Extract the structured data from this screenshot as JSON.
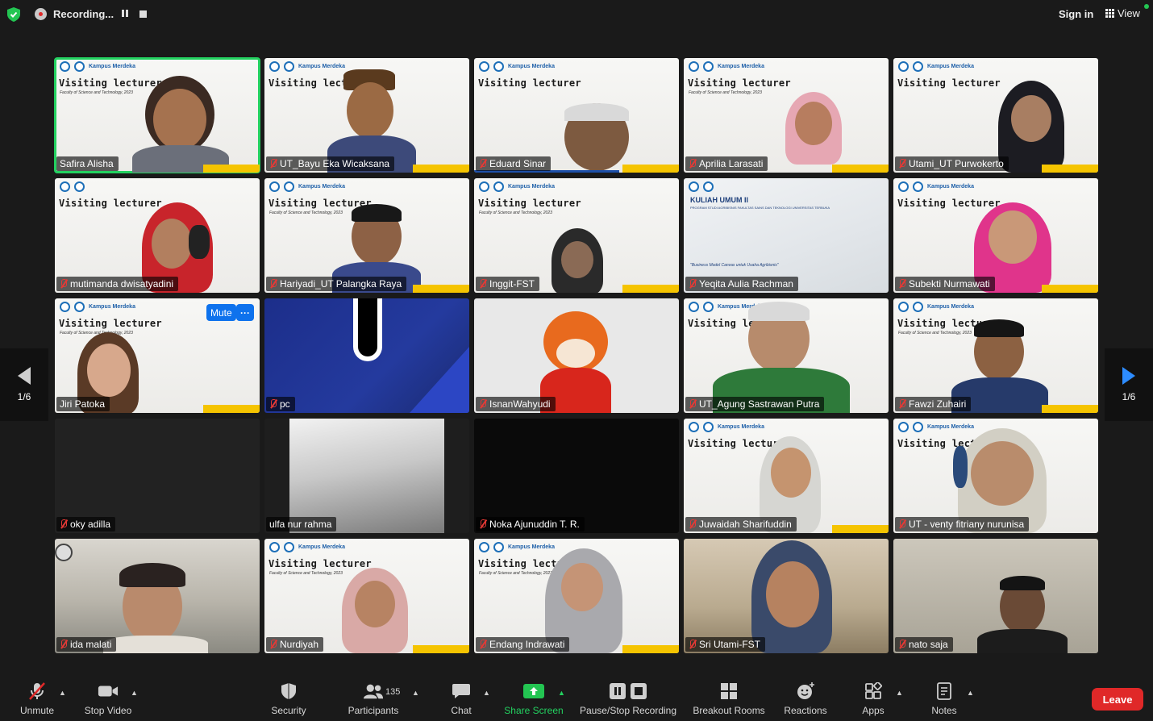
{
  "topbar": {
    "recording_label": "Recording...",
    "sign_in": "Sign in",
    "view": "View"
  },
  "pager": {
    "left": "1/6",
    "right": "1/6"
  },
  "slide": {
    "title": "Visiting lecturer",
    "subtitle": "Faculty of Science and Technology, 2023",
    "kampus": "Kampus Merdeka"
  },
  "kuliah": {
    "title": "KULIAH UMUM II",
    "subtitle": "PROGRAM STUDI AGRIBISNIS FAKULTAS SAINS DAN TEKNOLOGI UNIVERSITAS TERBUKA",
    "quote": "\"Business Model Canvas untuk Usaha Agribisnis\""
  },
  "tile_controls": {
    "mute": "Mute",
    "more": "···"
  },
  "participants": [
    {
      "name": "Safira Alisha",
      "muted": false
    },
    {
      "name": "UT_Bayu Eka Wicaksana",
      "muted": true
    },
    {
      "name": "Eduard Sinar",
      "muted": true
    },
    {
      "name": "Aprilia Larasati",
      "muted": true
    },
    {
      "name": "Utami_UT Purwokerto",
      "muted": true
    },
    {
      "name": "mutimanda dwisatyadini",
      "muted": true
    },
    {
      "name": "Hariyadi_UT Palangka Raya",
      "muted": true
    },
    {
      "name": "Inggit-FST",
      "muted": true
    },
    {
      "name": "Yeqita Aulia Rachman",
      "muted": true
    },
    {
      "name": "Subekti Nurmawati",
      "muted": true
    },
    {
      "name": "Jiri Patoka",
      "muted": false
    },
    {
      "name": "pc",
      "muted": true
    },
    {
      "name": "IsnanWahyudi",
      "muted": true
    },
    {
      "name": "UT_Agung Sastrawan Putra",
      "muted": true
    },
    {
      "name": "Fawzi Zuhairi",
      "muted": true
    },
    {
      "name": "oky adilla",
      "muted": true
    },
    {
      "name": "ulfa nur rahma",
      "muted": false
    },
    {
      "name": "Noka Ajunuddin T. R.",
      "muted": true
    },
    {
      "name": "Juwaidah Sharifuddin",
      "muted": true
    },
    {
      "name": "UT - venty fitriany nurunisa",
      "muted": true
    },
    {
      "name": "ida malati",
      "muted": true
    },
    {
      "name": "Nurdiyah",
      "muted": true
    },
    {
      "name": "Endang Indrawati",
      "muted": true
    },
    {
      "name": "Sri Utami-FST",
      "muted": true
    },
    {
      "name": "nato saja",
      "muted": true
    }
  ],
  "toolbar": {
    "unmute": "Unmute",
    "stop_video": "Stop Video",
    "security": "Security",
    "participants": "Participants",
    "participants_count": "135",
    "chat": "Chat",
    "share_screen": "Share Screen",
    "pause_stop_recording": "Pause/Stop Recording",
    "breakout_rooms": "Breakout Rooms",
    "reactions": "Reactions",
    "apps": "Apps",
    "notes": "Notes",
    "leave": "Leave"
  },
  "colors": {
    "accent": "#0e72ed",
    "active_speaker": "#23d160",
    "leave": "#e02828",
    "share": "#23c552"
  }
}
